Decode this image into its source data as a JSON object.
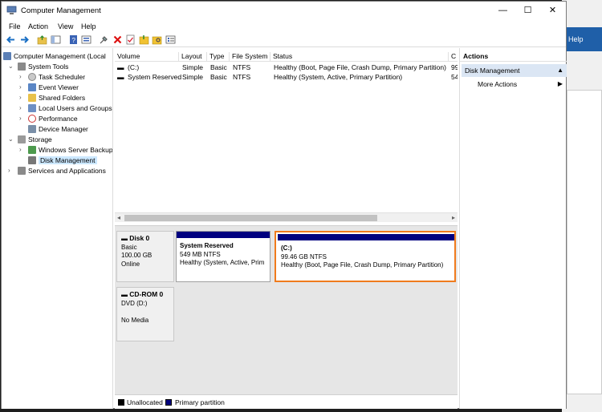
{
  "background_window": {
    "help_label": "Help"
  },
  "window": {
    "title": "Computer Management"
  },
  "titlebar": {
    "minimize": "—",
    "maximize": "☐",
    "close": "✕"
  },
  "menu": [
    "File",
    "Action",
    "View",
    "Help"
  ],
  "tree": {
    "root": "Computer Management (Local",
    "system_tools": "System Tools",
    "task_scheduler": "Task Scheduler",
    "event_viewer": "Event Viewer",
    "shared_folders": "Shared Folders",
    "local_users": "Local Users and Groups",
    "performance": "Performance",
    "device_manager": "Device Manager",
    "storage": "Storage",
    "windows_server_backup": "Windows Server Backup",
    "disk_management": "Disk Management",
    "services": "Services and Applications"
  },
  "volume_list": {
    "columns": [
      "Volume",
      "Layout",
      "Type",
      "File System",
      "Status",
      "C"
    ],
    "rows": [
      {
        "volume": "(C:)",
        "layout": "Simple",
        "type": "Basic",
        "fs": "NTFS",
        "status": "Healthy (Boot, Page File, Crash Dump, Primary Partition)",
        "c": "99"
      },
      {
        "volume": "System Reserved",
        "layout": "Simple",
        "type": "Basic",
        "fs": "NTFS",
        "status": "Healthy (System, Active, Primary Partition)",
        "c": "54"
      }
    ]
  },
  "disks": {
    "disk0": {
      "name": "Disk 0",
      "kind": "Basic",
      "size": "100.00 GB",
      "state": "Online",
      "partitions": [
        {
          "name": "System Reserved",
          "size": "549 MB NTFS",
          "status": "Healthy (System, Active, Prim"
        },
        {
          "name": "(C:)",
          "size": "99.46 GB NTFS",
          "status": "Healthy (Boot, Page File, Crash Dump, Primary Partition)"
        }
      ]
    },
    "cdrom0": {
      "name": "CD-ROM 0",
      "kind": "DVD (D:)",
      "media": "No Media"
    }
  },
  "legend": {
    "unallocated": "Unallocated",
    "primary": "Primary partition"
  },
  "actions": {
    "header": "Actions",
    "section": "Disk Management",
    "more": "More Actions"
  },
  "colors": {
    "primary_partition": "#00007f",
    "highlight": "#f07b1d",
    "selection": "#cce8ff"
  }
}
